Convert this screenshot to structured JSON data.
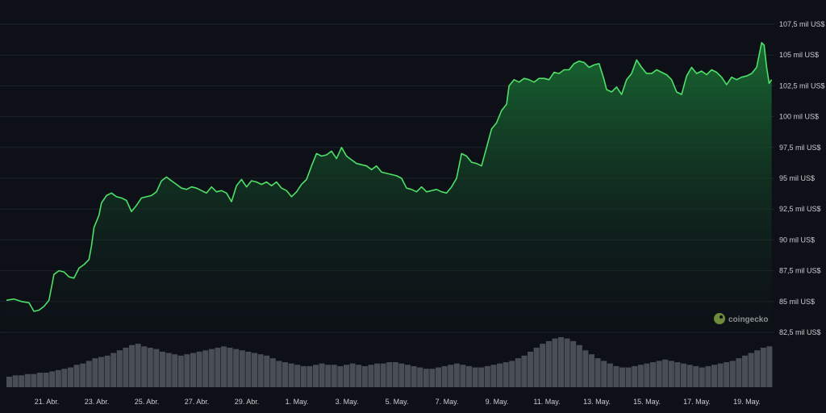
{
  "chart_data": {
    "type": "area",
    "ylim": [
      82500,
      107500
    ],
    "xlim": [
      0,
      29.4
    ],
    "grid": true,
    "x_tick_positions": [
      1,
      3,
      5,
      7,
      9,
      11,
      13,
      15,
      17,
      19,
      21,
      23,
      25,
      27,
      29
    ],
    "x_tick_labels": [
      "21. Abr.",
      "23. Abr.",
      "25. Abr.",
      "27. Abr.",
      "29. Abr.",
      "1. May.",
      "3. May.",
      "5. May.",
      "7. May.",
      "9. May.",
      "11. May.",
      "13. May.",
      "15. May.",
      "17. May.",
      "19. May."
    ],
    "y_ticks": [
      82500,
      85000,
      87500,
      90000,
      92500,
      95000,
      97500,
      100000,
      102500,
      105000,
      107500
    ],
    "y_tick_labels": [
      "82,5 mil US$",
      "85 mil US$",
      "87,5 mil US$",
      "90 mil US$",
      "92,5 mil US$",
      "95 mil US$",
      "97,5 mil US$",
      "100 mil US$",
      "102,5 mil US$",
      "105 mil US$",
      "107,5 mil US$"
    ],
    "series": [
      {
        "values": [
          [
            0,
            85100
          ],
          [
            0.3,
            85200
          ],
          [
            0.6,
            85000
          ],
          [
            0.9,
            84900
          ],
          [
            1.1,
            84200
          ],
          [
            1.3,
            84300
          ],
          [
            1.5,
            84600
          ],
          [
            1.7,
            85100
          ],
          [
            1.9,
            87200
          ],
          [
            2.1,
            87500
          ],
          [
            2.3,
            87400
          ],
          [
            2.5,
            87000
          ],
          [
            2.7,
            86900
          ],
          [
            2.9,
            87700
          ],
          [
            3.1,
            88000
          ],
          [
            3.3,
            88400
          ],
          [
            3.4,
            89500
          ],
          [
            3.5,
            91000
          ],
          [
            3.7,
            92000
          ],
          [
            3.8,
            93000
          ],
          [
            4.0,
            93600
          ],
          [
            4.2,
            93800
          ],
          [
            4.4,
            93500
          ],
          [
            4.6,
            93400
          ],
          [
            4.8,
            93200
          ],
          [
            5.0,
            92300
          ],
          [
            5.2,
            92800
          ],
          [
            5.4,
            93400
          ],
          [
            5.6,
            93500
          ],
          [
            5.8,
            93600
          ],
          [
            6.0,
            93900
          ],
          [
            6.2,
            94800
          ],
          [
            6.4,
            95100
          ],
          [
            6.6,
            94800
          ],
          [
            6.8,
            94500
          ],
          [
            7.0,
            94200
          ],
          [
            7.2,
            94100
          ],
          [
            7.4,
            94300
          ],
          [
            7.6,
            94200
          ],
          [
            7.8,
            94000
          ],
          [
            8.0,
            93800
          ],
          [
            8.2,
            94300
          ],
          [
            8.4,
            93900
          ],
          [
            8.6,
            94000
          ],
          [
            8.8,
            93800
          ],
          [
            9.0,
            93100
          ],
          [
            9.2,
            94400
          ],
          [
            9.4,
            94900
          ],
          [
            9.6,
            94300
          ],
          [
            9.8,
            94800
          ],
          [
            10.0,
            94700
          ],
          [
            10.2,
            94500
          ],
          [
            10.4,
            94700
          ],
          [
            10.6,
            94400
          ],
          [
            10.8,
            94700
          ],
          [
            11.0,
            94200
          ],
          [
            11.2,
            94000
          ],
          [
            11.4,
            93500
          ],
          [
            11.6,
            93900
          ],
          [
            11.8,
            94500
          ],
          [
            12.0,
            94900
          ],
          [
            12.2,
            96000
          ],
          [
            12.4,
            97000
          ],
          [
            12.6,
            96800
          ],
          [
            12.8,
            96900
          ],
          [
            13.0,
            97200
          ],
          [
            13.2,
            96600
          ],
          [
            13.4,
            97500
          ],
          [
            13.6,
            96800
          ],
          [
            13.8,
            96500
          ],
          [
            14.0,
            96200
          ],
          [
            14.2,
            96100
          ],
          [
            14.4,
            96000
          ],
          [
            14.6,
            95700
          ],
          [
            14.8,
            96000
          ],
          [
            15.0,
            95500
          ],
          [
            15.2,
            95400
          ],
          [
            15.4,
            95300
          ],
          [
            15.6,
            95200
          ],
          [
            15.8,
            95000
          ],
          [
            16.0,
            94200
          ],
          [
            16.2,
            94100
          ],
          [
            16.4,
            93900
          ],
          [
            16.6,
            94300
          ],
          [
            16.8,
            93900
          ],
          [
            17.0,
            94000
          ],
          [
            17.2,
            94100
          ],
          [
            17.4,
            93900
          ],
          [
            17.6,
            93800
          ],
          [
            17.8,
            94300
          ],
          [
            18.0,
            95000
          ],
          [
            18.2,
            97000
          ],
          [
            18.4,
            96800
          ],
          [
            18.6,
            96300
          ],
          [
            18.8,
            96200
          ],
          [
            19.0,
            96000
          ],
          [
            19.2,
            97500
          ],
          [
            19.4,
            99000
          ],
          [
            19.6,
            99500
          ],
          [
            19.8,
            100500
          ],
          [
            20.0,
            101000
          ],
          [
            20.1,
            102500
          ],
          [
            20.3,
            103000
          ],
          [
            20.5,
            102800
          ],
          [
            20.7,
            103100
          ],
          [
            20.9,
            103000
          ],
          [
            21.1,
            102800
          ],
          [
            21.3,
            103100
          ],
          [
            21.5,
            103100
          ],
          [
            21.7,
            103000
          ],
          [
            21.9,
            103600
          ],
          [
            22.1,
            103500
          ],
          [
            22.3,
            103800
          ],
          [
            22.5,
            103800
          ],
          [
            22.7,
            104300
          ],
          [
            22.9,
            104500
          ],
          [
            23.1,
            104400
          ],
          [
            23.3,
            104000
          ],
          [
            23.5,
            104200
          ],
          [
            23.7,
            104300
          ],
          [
            23.9,
            103000
          ],
          [
            24.0,
            102200
          ],
          [
            24.2,
            102000
          ],
          [
            24.4,
            102400
          ],
          [
            24.6,
            101800
          ],
          [
            24.8,
            103000
          ],
          [
            25.0,
            103500
          ],
          [
            25.2,
            104600
          ],
          [
            25.4,
            104000
          ],
          [
            25.6,
            103500
          ],
          [
            25.8,
            103500
          ],
          [
            26.0,
            103800
          ],
          [
            26.2,
            103600
          ],
          [
            26.4,
            103400
          ],
          [
            26.6,
            103000
          ],
          [
            26.8,
            102000
          ],
          [
            27.0,
            101800
          ],
          [
            27.2,
            103300
          ],
          [
            27.4,
            104000
          ],
          [
            27.6,
            103500
          ],
          [
            27.8,
            103700
          ],
          [
            28.0,
            103400
          ],
          [
            28.2,
            103800
          ],
          [
            28.4,
            103600
          ],
          [
            28.6,
            103200
          ],
          [
            28.8,
            102600
          ],
          [
            29.0,
            103200
          ],
          [
            29.2,
            103000
          ],
          [
            29.4,
            103200
          ],
          [
            29.6,
            103300
          ],
          [
            29.8,
            103500
          ],
          [
            30.0,
            104000
          ],
          [
            30.2,
            106000
          ],
          [
            30.3,
            105800
          ],
          [
            30.4,
            104000
          ],
          [
            30.5,
            102700
          ],
          [
            30.6,
            103000
          ]
        ]
      }
    ],
    "volume": [
      8,
      9,
      9,
      10,
      10,
      11,
      11,
      12,
      13,
      14,
      15,
      17,
      18,
      20,
      22,
      23,
      24,
      26,
      28,
      30,
      32,
      33,
      31,
      30,
      29,
      27,
      26,
      25,
      24,
      25,
      26,
      27,
      28,
      29,
      30,
      31,
      30,
      29,
      28,
      27,
      26,
      25,
      24,
      22,
      20,
      19,
      18,
      17,
      16,
      16,
      17,
      18,
      17,
      17,
      16,
      17,
      18,
      17,
      16,
      17,
      18,
      18,
      19,
      19,
      18,
      17,
      16,
      15,
      14,
      14,
      15,
      16,
      17,
      18,
      17,
      16,
      15,
      15,
      16,
      17,
      18,
      19,
      20,
      22,
      24,
      27,
      30,
      33,
      35,
      37,
      38,
      37,
      35,
      32,
      28,
      25,
      22,
      20,
      18,
      16,
      15,
      15,
      16,
      17,
      18,
      19,
      20,
      21,
      20,
      19,
      18,
      17,
      16,
      15,
      16,
      17,
      18,
      19,
      20,
      22,
      24,
      26,
      28,
      30,
      31
    ]
  },
  "brand": {
    "name": "coingecko",
    "line_color": "#4ee067"
  },
  "colors": {
    "line": "#4ee067",
    "background": "#0d1117",
    "grid": "#1e232b"
  }
}
